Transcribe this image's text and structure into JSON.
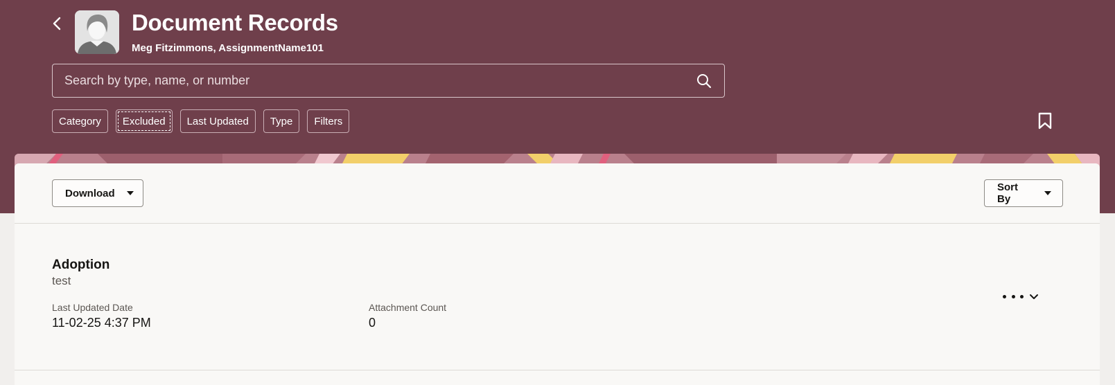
{
  "header": {
    "title": "Document Records",
    "subtitle": "Meg Fitzimmons, AssignmentName101",
    "back_icon": "chevron-left-icon",
    "avatar": "person-avatar",
    "bg_color": "#6f3f4b"
  },
  "search": {
    "placeholder": "Search by type, name, or number",
    "value": "",
    "icon": "search-icon"
  },
  "filter_chips": [
    {
      "label": "Category"
    },
    {
      "label": "Excluded",
      "focused": true
    },
    {
      "label": "Last Updated"
    },
    {
      "label": "Type"
    },
    {
      "label": "Filters"
    }
  ],
  "bookmark_icon": "bookmark-icon",
  "toolbar": {
    "download_label": "Download",
    "sort_label": "Sort By"
  },
  "records": [
    {
      "title": "Adoption",
      "subtitle": "test",
      "fields": [
        {
          "label": "Last Updated Date",
          "value": "11-02-25 4:37 PM"
        },
        {
          "label": "Attachment Count",
          "value": "0"
        }
      ]
    }
  ]
}
